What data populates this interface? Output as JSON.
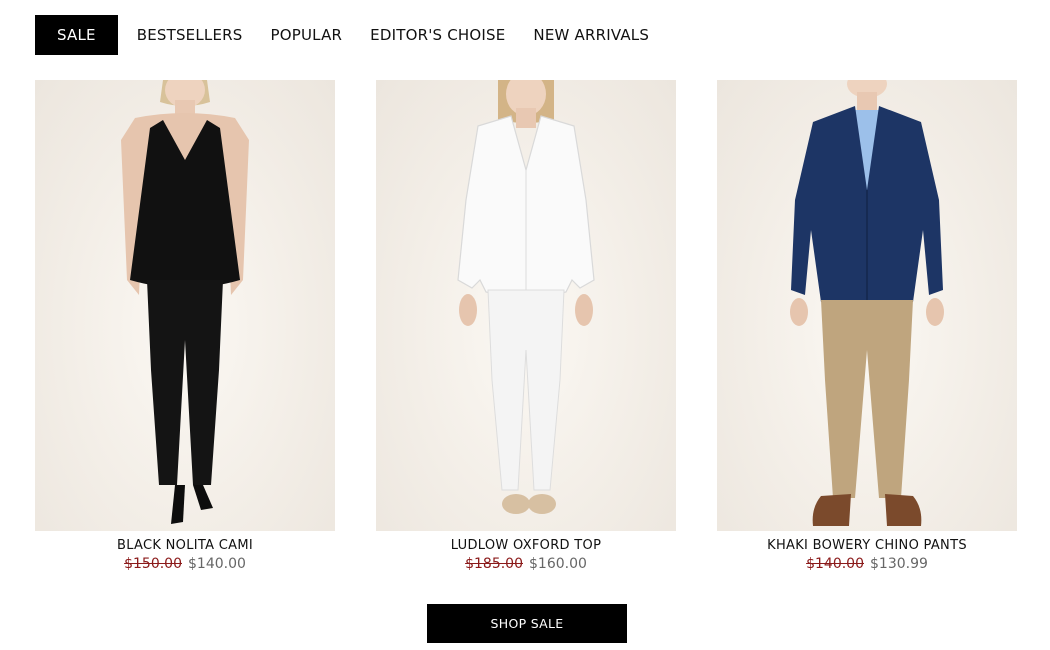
{
  "tabs": [
    {
      "label": "SALE",
      "active": true
    },
    {
      "label": "BESTSELLERS",
      "active": false
    },
    {
      "label": "POPULAR",
      "active": false
    },
    {
      "label": "EDITOR'S CHOISE",
      "active": false
    },
    {
      "label": "NEW ARRIVALS",
      "active": false
    }
  ],
  "products": [
    {
      "name": "BLACK NOLITA CAMI",
      "old_price": "$150.00",
      "new_price": "$140.00"
    },
    {
      "name": "LUDLOW OXFORD TOP",
      "old_price": "$185.00",
      "new_price": "$160.00"
    },
    {
      "name": "KHAKI BOWERY CHINO PANTS",
      "old_price": "$140.00",
      "new_price": "$130.99"
    }
  ],
  "shop_button": {
    "label": "SHOP SALE"
  },
  "colors": {
    "accent": "#000000",
    "old_price": "#8b1a1a",
    "new_price": "#666666"
  }
}
